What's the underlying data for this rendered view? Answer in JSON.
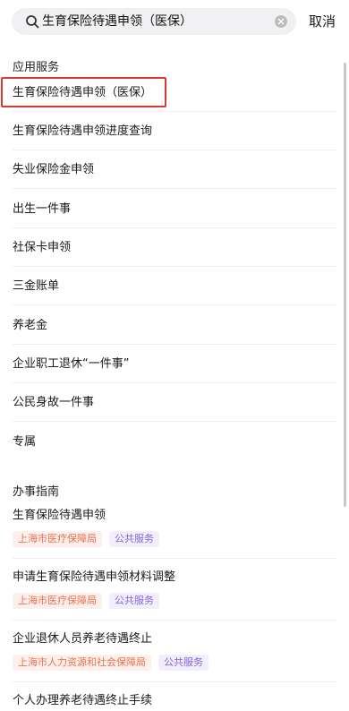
{
  "search": {
    "query": "生育保险待遇申领（医保）"
  },
  "cancel_label": "取消",
  "app_section": {
    "title": "应用服务",
    "items": [
      {
        "label": "生育保险待遇申领（医保）"
      },
      {
        "label": "生育保险待遇申领进度查询"
      },
      {
        "label": "失业保险金申领"
      },
      {
        "label": "出生一件事"
      },
      {
        "label": "社保卡申领"
      },
      {
        "label": "三金账单"
      },
      {
        "label": "养老金"
      },
      {
        "label": "企业职工退休“一件事”"
      },
      {
        "label": "公民身故一件事"
      },
      {
        "label": "专属"
      }
    ]
  },
  "guide_section": {
    "title": "办事指南",
    "items": [
      {
        "title": "生育保险待遇申领",
        "org": "上海市医疗保障局",
        "type": "公共服务"
      },
      {
        "title": "申请生育保险待遇申领材料调整",
        "org": "上海市医疗保障局",
        "type": "公共服务"
      },
      {
        "title": "企业退休人员养老待遇终止",
        "org": "上海市人力资源和社会保障局",
        "type": "公共服务"
      },
      {
        "title": "个人办理养老待遇终止手续"
      }
    ]
  },
  "colors": {
    "highlight": "#d83a2e",
    "org_tag": "#e8734f",
    "service_tag": "#8567d6"
  }
}
